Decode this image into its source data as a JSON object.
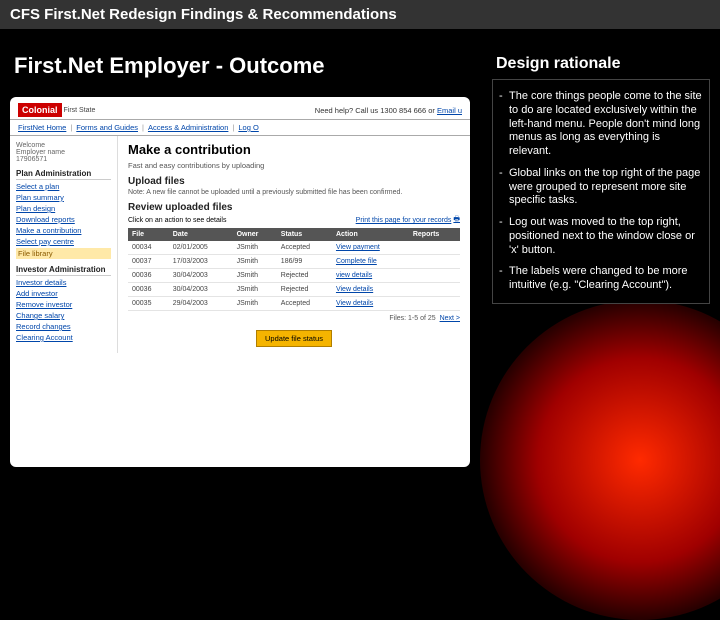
{
  "header": "CFS First.Net Redesign Findings & Recommendations",
  "slideTitle": "First.Net Employer - Outcome",
  "mock": {
    "logoBox": "Colonial",
    "logoSub": "First State",
    "help": "Need help? Call us 1300 854 666 or",
    "helpLink": "Email u",
    "nav": [
      "FirstNet Home",
      "Forms and Guides",
      "Access & Administration",
      "Log O"
    ],
    "welcome": {
      "l1": "Welcome",
      "l2": "Employer name",
      "l3": "17906571"
    },
    "sections": [
      {
        "heading": "Plan Administration",
        "links": [
          {
            "t": "Select a plan"
          },
          {
            "t": "Plan summary"
          },
          {
            "t": "Plan design"
          },
          {
            "t": "Download reports"
          },
          {
            "t": "Make a contribution"
          },
          {
            "t": "Select pay centre"
          },
          {
            "t": "File library",
            "active": true
          }
        ]
      },
      {
        "heading": "Investor Administration",
        "links": [
          {
            "t": "Investor details"
          },
          {
            "t": "Add investor"
          },
          {
            "t": "Remove investor"
          },
          {
            "t": "Change salary"
          },
          {
            "t": "Record changes"
          },
          {
            "t": "Clearing Account"
          }
        ]
      }
    ],
    "content": {
      "h1": "Make a contribution",
      "sub": "Fast and easy contributions by uploading",
      "h2a": "Upload files",
      "note": "Note: A new file cannot be uploaded until a previously submitted file has been confirmed.",
      "h2b": "Review uploaded files",
      "clickAction": "Click on an action to see details",
      "printLabel": "Print this page for your records",
      "cols": [
        "File",
        "Date",
        "Owner",
        "Status",
        "Action",
        "Reports"
      ],
      "rows": [
        {
          "file": "00034",
          "date": "02/01/2005",
          "owner": "JSmith",
          "status": "Accepted",
          "action": "View payment",
          "rep": ""
        },
        {
          "file": "00037",
          "date": "17/03/2003",
          "owner": "JSmith",
          "status": "186/99",
          "action": "Complete file",
          "rep": ""
        },
        {
          "file": "00036",
          "date": "30/04/2003",
          "owner": "JSmith",
          "status": "Rejected",
          "action": "view details",
          "rep": ""
        },
        {
          "file": "00036",
          "date": "30/04/2003",
          "owner": "JSmith",
          "status": "Rejected",
          "action": "View details",
          "rep": ""
        },
        {
          "file": "00035",
          "date": "29/04/2003",
          "owner": "JSmith",
          "status": "Accepted",
          "action": "View details",
          "rep": ""
        }
      ],
      "pager": "Files: 1-5 of 25",
      "pagerNext": "Next >",
      "btn": "Update file status"
    }
  },
  "rationale": {
    "heading": "Design rationale",
    "items": [
      "The core things people come to the site to do are located exclusively within the left-hand menu. People don't mind long menus as long as everything is relevant.",
      "Global links on the top right of the page were grouped to represent more site specific tasks.",
      "Log out was moved to the top right, positioned next to the window close or 'x' button.",
      "The labels were changed to be more intuitive (e.g. \"Clearing Account\")."
    ]
  }
}
